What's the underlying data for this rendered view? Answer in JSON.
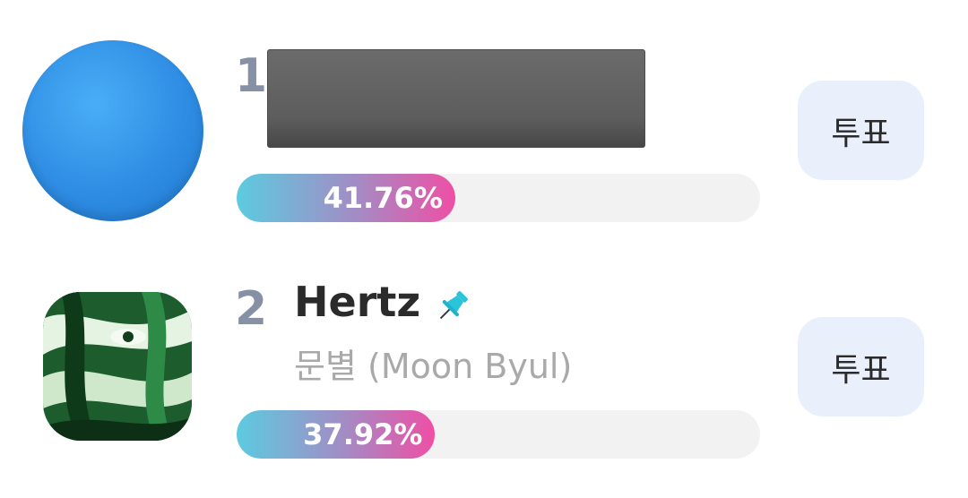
{
  "entries": [
    {
      "rank": "1",
      "title": "",
      "artist": "",
      "percent_value": 41.76,
      "percent_label": "41.76%",
      "vote_label": "투표",
      "thumbnail": "blue-circle-artwork"
    },
    {
      "rank": "2",
      "title": "Hertz",
      "title_icon": "pushpin-icon",
      "artist": "문별 (Moon Byul)",
      "percent_value": 37.92,
      "percent_label": "37.92%",
      "vote_label": "투표",
      "thumbnail": "album-cover-green"
    }
  ],
  "colors": {
    "bar_gradient_start": "#5ccbe0",
    "bar_gradient_end": "#ef4fa5",
    "rank_color": "#8791a6",
    "vote_button_bg": "#eaf0fb",
    "pin_color": "#29c4d9"
  }
}
